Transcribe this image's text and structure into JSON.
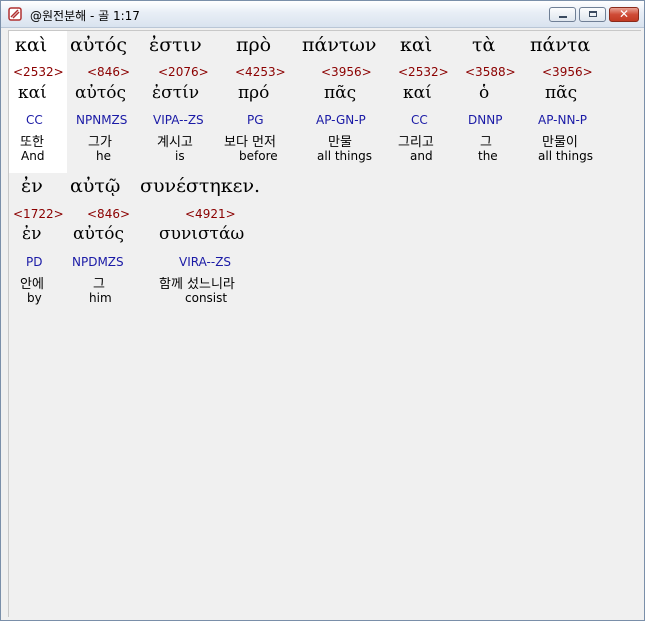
{
  "window": {
    "title": "@원전분해 - 골 1:17",
    "buttons": {
      "minimize": "_",
      "maximize": "□",
      "close": "✕"
    }
  },
  "rows": [
    {
      "words": [
        {
          "greek": "καὶ",
          "strong": "<2532>",
          "lemma": "καί",
          "parse": "CC",
          "korean": "또한",
          "english": "And"
        },
        {
          "greek": "αὐτός",
          "strong": "<846>",
          "lemma": "αὐτός",
          "parse": "NPNMZS",
          "korean": "그가",
          "english": "he"
        },
        {
          "greek": "ἐστιν",
          "strong": "<2076>",
          "lemma": "ἐστίν",
          "parse": "VIPA--ZS",
          "korean": "계시고",
          "english": "is"
        },
        {
          "greek": "πρὸ",
          "strong": "<4253>",
          "lemma": "πρό",
          "parse": "PG",
          "korean": "보다 먼저",
          "english": "before"
        },
        {
          "greek": "πάντων",
          "strong": "<3956>",
          "lemma": "πᾶς",
          "parse": "AP-GN-P",
          "korean": "만물",
          "english": "all things"
        },
        {
          "greek": "καὶ",
          "strong": "<2532>",
          "lemma": "καί",
          "parse": "CC",
          "korean": "그리고",
          "english": "and"
        },
        {
          "greek": "τὰ",
          "strong": "<3588>",
          "lemma": "ὁ",
          "parse": "DNNP",
          "korean": "그",
          "english": "the"
        },
        {
          "greek": "πάντα",
          "strong": "<3956>",
          "lemma": "πᾶς",
          "parse": "AP-NN-P",
          "korean": "만물이",
          "english": "all things"
        }
      ]
    },
    {
      "words": [
        {
          "greek": "ἐν",
          "strong": "<1722>",
          "lemma": "ἐν",
          "parse": "PD",
          "korean": "안에",
          "english": "by"
        },
        {
          "greek": "αὐτῷ",
          "strong": "<846>",
          "lemma": "αὐτός",
          "parse": "NPDMZS",
          "korean": "그",
          "english": "him"
        },
        {
          "greek": "συνέστηκεν.",
          "strong": "<4921>",
          "lemma": "συνιστάω",
          "parse": "VIRA--ZS",
          "korean": "함께 섰느니라",
          "english": "consist"
        }
      ]
    }
  ]
}
